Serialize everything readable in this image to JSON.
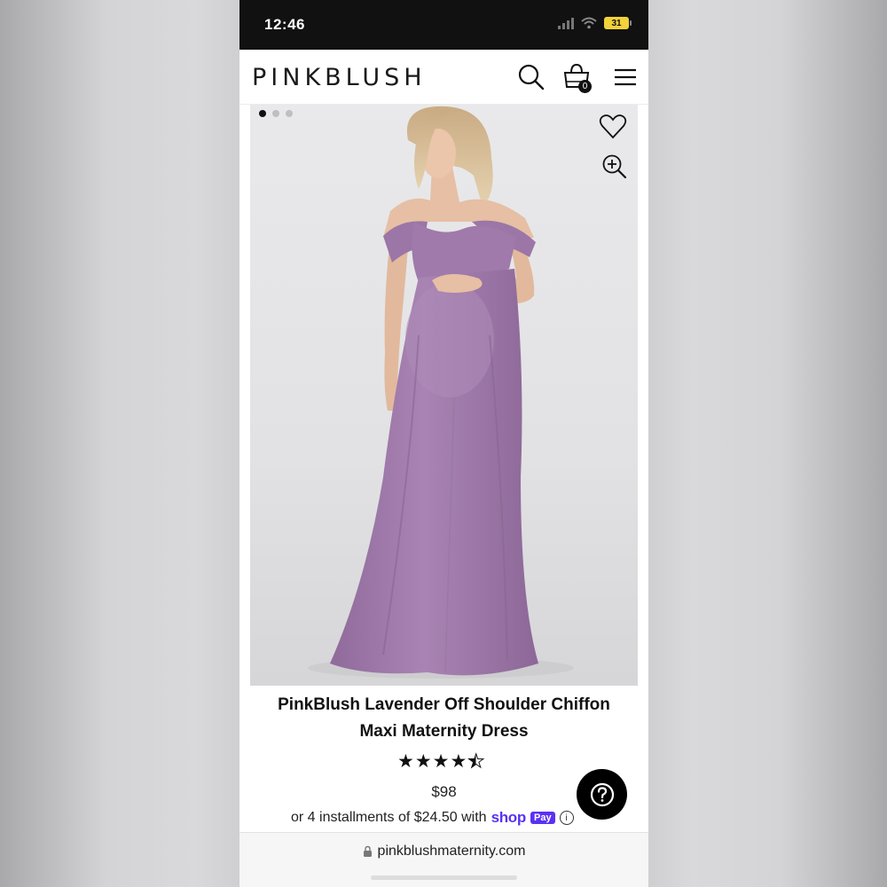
{
  "status_bar": {
    "time": "12:46",
    "battery": "31"
  },
  "header": {
    "brand": "PINKBLUSH",
    "cart_count": "0",
    "icons": [
      "search-icon",
      "shopping-bag-icon",
      "hamburger-menu-icon"
    ]
  },
  "gallery": {
    "dot_count": 3,
    "active_dot": 1,
    "icons": [
      "heart-icon",
      "zoom-in-icon"
    ],
    "dress_color": "#a67eb0"
  },
  "product": {
    "title": "PinkBlush Lavender Off Shoulder Chiffon Maxi Maternity Dress",
    "rating": 4.5,
    "rating_max": 5,
    "price": "$98",
    "installments_text": "or 4 installments of $24.50 with",
    "shop_logo": "shop",
    "pay_badge": "Pay",
    "info_symbol": "i"
  },
  "help": {
    "symbol": "?"
  },
  "browser": {
    "url": "pinkblushmaternity.com"
  },
  "colors": {
    "shop_pay": "#5a31f4",
    "status_bar": "#111111",
    "battery": "#f1d23a"
  }
}
